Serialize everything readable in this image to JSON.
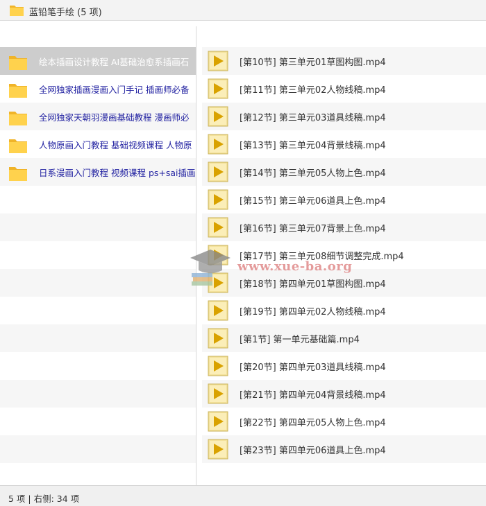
{
  "window": {
    "title": "蓝铅笔手绘 (5 项)",
    "icon": "folder-icon"
  },
  "left_pane": {
    "items": [
      {
        "label": "绘本插画设计教程 AI基础治愈系插画石",
        "selected": true
      },
      {
        "label": "全网独家插画漫画入门手记 插画师必备",
        "selected": false
      },
      {
        "label": "全网独家天朝羽漫画基础教程 漫画师必",
        "selected": false
      },
      {
        "label": "人物原画入门教程 基础视频课程 人物原",
        "selected": false
      },
      {
        "label": "日系漫画入门教程 视频课程 ps+sai插画",
        "selected": false
      }
    ]
  },
  "right_pane": {
    "files": [
      {
        "name": "[第10节] 第三单元01草图构图.mp4",
        "icon": "video-file-icon"
      },
      {
        "name": "[第11节] 第三单元02人物线稿.mp4",
        "icon": "video-file-icon"
      },
      {
        "name": "[第12节] 第三单元03道具线稿.mp4",
        "icon": "video-file-icon"
      },
      {
        "name": "[第13节] 第三单元04背景线稿.mp4",
        "icon": "video-file-icon"
      },
      {
        "name": "[第14节] 第三单元05人物上色.mp4",
        "icon": "video-file-icon"
      },
      {
        "name": "[第15节] 第三单元06道具上色.mp4",
        "icon": "video-file-icon"
      },
      {
        "name": "[第16节] 第三单元07背景上色.mp4",
        "icon": "video-file-icon"
      },
      {
        "name": "[第17节] 第三单元08细节调整完成.mp4",
        "icon": "video-file-icon"
      },
      {
        "name": "[第18节] 第四单元01草图构图.mp4",
        "icon": "video-file-icon"
      },
      {
        "name": "[第19节] 第四单元02人物线稿.mp4",
        "icon": "video-file-icon"
      },
      {
        "name": "[第1节] 第一单元基础篇.mp4",
        "icon": "video-file-icon"
      },
      {
        "name": "[第20节] 第四单元03道具线稿.mp4",
        "icon": "video-file-icon"
      },
      {
        "name": "[第21节] 第四单元04背景线稿.mp4",
        "icon": "video-file-icon"
      },
      {
        "name": "[第22节] 第四单元05人物上色.mp4",
        "icon": "video-file-icon"
      },
      {
        "name": "[第23节] 第四单元06道具上色.mp4",
        "icon": "video-file-icon"
      }
    ]
  },
  "watermark": {
    "text": "www.xue-ba.org",
    "icon": "graduation-cap-icon"
  },
  "statusbar": {
    "text": "5 项 | 右侧: 34 项"
  },
  "colors": {
    "folder_fill": "#ffd24d",
    "folder_tab": "#f0b429",
    "video_fill": "#f3e19a",
    "video_arrow": "#d9a200",
    "left_link": "#1f1fa0",
    "selected_row": "#cdcdcd"
  }
}
